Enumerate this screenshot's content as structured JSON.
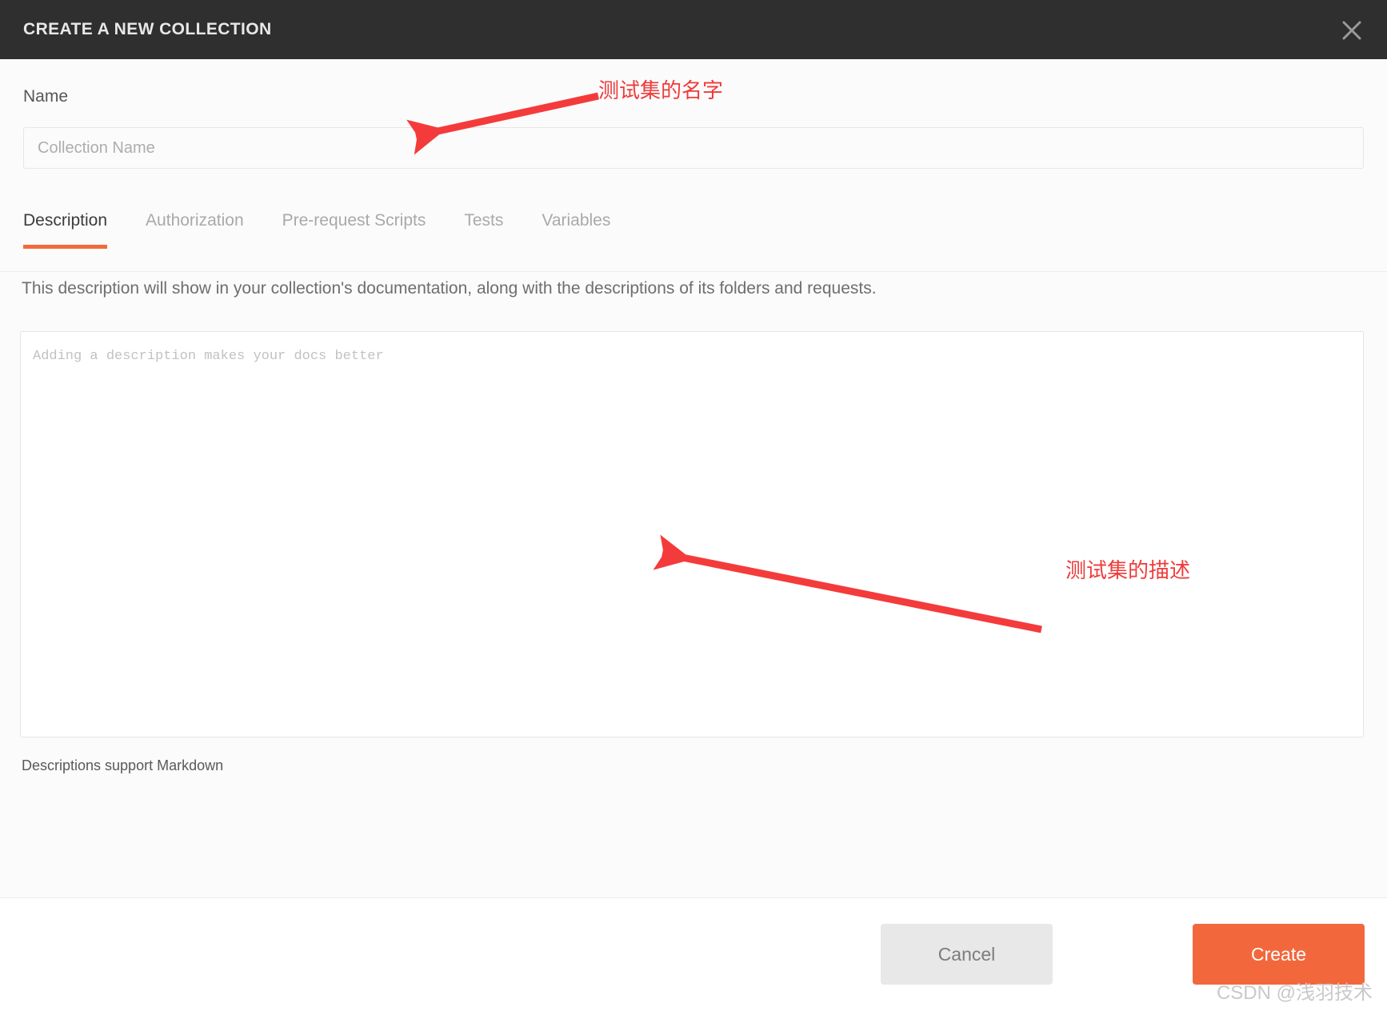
{
  "header": {
    "title": "CREATE A NEW COLLECTION",
    "close_icon": "close-icon"
  },
  "form": {
    "name_label": "Name",
    "name_placeholder": "Collection Name",
    "name_value": ""
  },
  "tabs": [
    {
      "label": "Description",
      "active": true
    },
    {
      "label": "Authorization",
      "active": false
    },
    {
      "label": "Pre-request Scripts",
      "active": false
    },
    {
      "label": "Tests",
      "active": false
    },
    {
      "label": "Variables",
      "active": false
    }
  ],
  "description": {
    "help_text": "This description will show in your collection's documentation, along with the descriptions of its folders and requests.",
    "textarea_placeholder": "Adding a description makes your docs better",
    "textarea_value": "",
    "markdown_note": "Descriptions support Markdown"
  },
  "footer": {
    "cancel_label": "Cancel",
    "create_label": "Create"
  },
  "annotations": [
    {
      "text": "测试集的名字",
      "target": "name-input"
    },
    {
      "text": "测试集的描述",
      "target": "description-textarea"
    }
  ],
  "watermark": "CSDN @浅羽技术",
  "colors": {
    "header_bg": "#2f2f2f",
    "accent": "#f26b3a",
    "create_button": "#f2683c",
    "cancel_button": "#e8e8e8",
    "annotation": "#ef3b3b",
    "body_bg": "#fbfbfb"
  }
}
